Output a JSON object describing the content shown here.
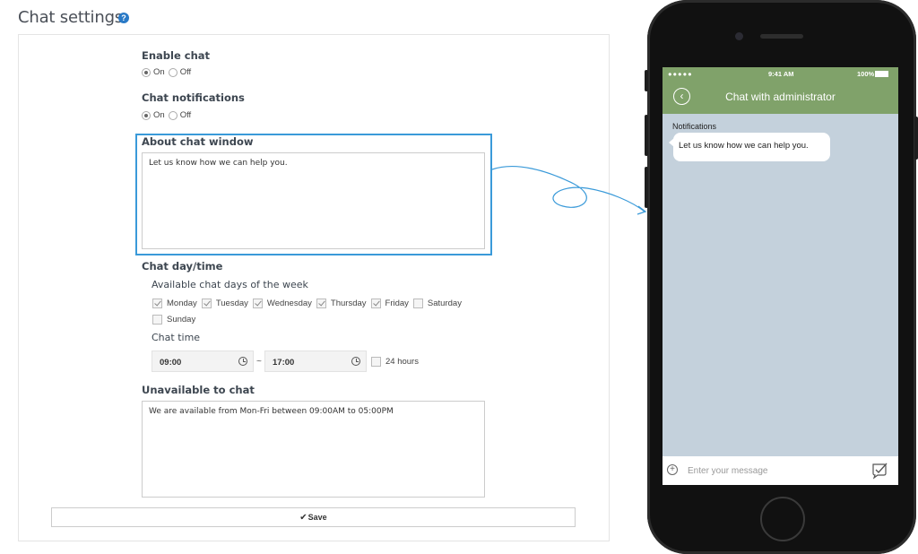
{
  "page": {
    "title": "Chat settings",
    "help_icon": "question-circle-icon",
    "help_glyph": "?"
  },
  "enable_chat": {
    "label": "Enable chat",
    "options": [
      "On",
      "Off"
    ],
    "selected": "On"
  },
  "chat_notifications": {
    "label": "Chat notifications",
    "options": [
      "On",
      "Off"
    ],
    "selected": "On"
  },
  "about_chat_window": {
    "label": "About chat window",
    "value": "Let us know how we can help you."
  },
  "chat_day_time": {
    "label": "Chat day/time",
    "days_label": "Available chat days of the week",
    "days": [
      {
        "name": "Monday",
        "checked": true
      },
      {
        "name": "Tuesday",
        "checked": true
      },
      {
        "name": "Wednesday",
        "checked": true
      },
      {
        "name": "Thursday",
        "checked": true
      },
      {
        "name": "Friday",
        "checked": true
      },
      {
        "name": "Saturday",
        "checked": false
      },
      {
        "name": "Sunday",
        "checked": false
      }
    ],
    "time_label": "Chat time",
    "start_time": "09:00",
    "separator": "~",
    "end_time": "17:00",
    "all_day_label": "24 hours",
    "all_day_checked": false
  },
  "unavailable": {
    "label": "Unavailable to chat",
    "value": "We are available from Mon-Fri between 09:00AM to 05:00PM"
  },
  "save": {
    "label": "Save",
    "glyph": "✔"
  },
  "phone": {
    "status": {
      "signal": "●●●●● ",
      "wifi": "wifi-icon",
      "time": "9:41 AM",
      "battery": "100%"
    },
    "header_title": "Chat with administrator",
    "back_glyph": "‹",
    "message_sender": "Notifications",
    "message_text": "Let us know how we can help you.",
    "input_placeholder": "Enter your message",
    "plus_glyph": "+",
    "colors": {
      "header": "#80a26a",
      "chat_background": "#c4d1dc"
    }
  },
  "colors": {
    "highlight": "#3a9ad9",
    "help_icon": "#2a7ac7"
  }
}
